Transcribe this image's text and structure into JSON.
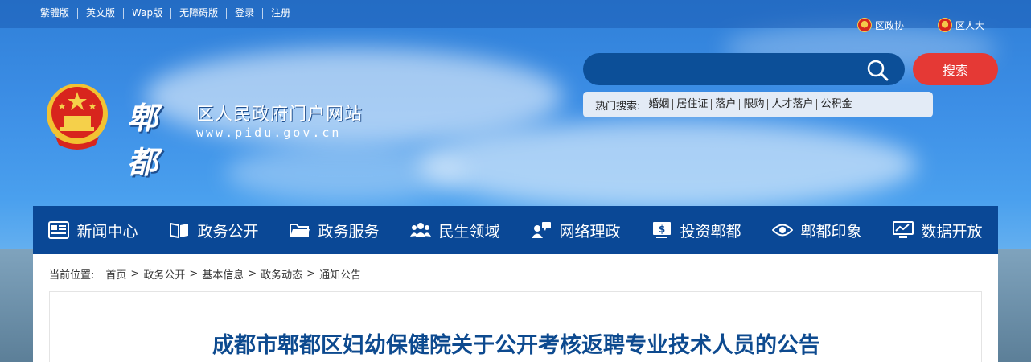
{
  "top_links": [
    "繁體版",
    "英文版",
    "Wap版",
    "无障碍版",
    "登录",
    "注册"
  ],
  "quick_links": [
    "区政协",
    "区人大"
  ],
  "site": {
    "calligraphy": "郫都",
    "title": "区人民政府门户网站",
    "url": "www.pidu.gov.cn"
  },
  "search": {
    "placeholder": "",
    "button_label": "搜索",
    "hot_label": "热门搜索:",
    "hot_terms": [
      "婚姻",
      "居住证",
      "落户",
      "限购",
      "人才落户",
      "公积金"
    ]
  },
  "nav": [
    {
      "label": "新闻中心",
      "icon": "newspaper-icon"
    },
    {
      "label": "政务公开",
      "icon": "book-icon"
    },
    {
      "label": "政务服务",
      "icon": "folder-icon"
    },
    {
      "label": "民生领域",
      "icon": "people-icon"
    },
    {
      "label": "网络理政",
      "icon": "chat-user-icon"
    },
    {
      "label": "投资郫都",
      "icon": "dollar-icon"
    },
    {
      "label": "郫都印象",
      "icon": "eye-icon"
    },
    {
      "label": "数据开放",
      "icon": "monitor-icon"
    }
  ],
  "breadcrumb": {
    "label": "当前位置:",
    "items": [
      "首页",
      "政务公开",
      "基本信息",
      "政务动态",
      "通知公告"
    ]
  },
  "article": {
    "title": "成都市郫都区妇幼保健院关于公开考核返聘专业技术人员的公告"
  },
  "colors": {
    "nav_bg": "#0a4896",
    "search_button": "#e53935",
    "title": "#0d4a8f"
  }
}
